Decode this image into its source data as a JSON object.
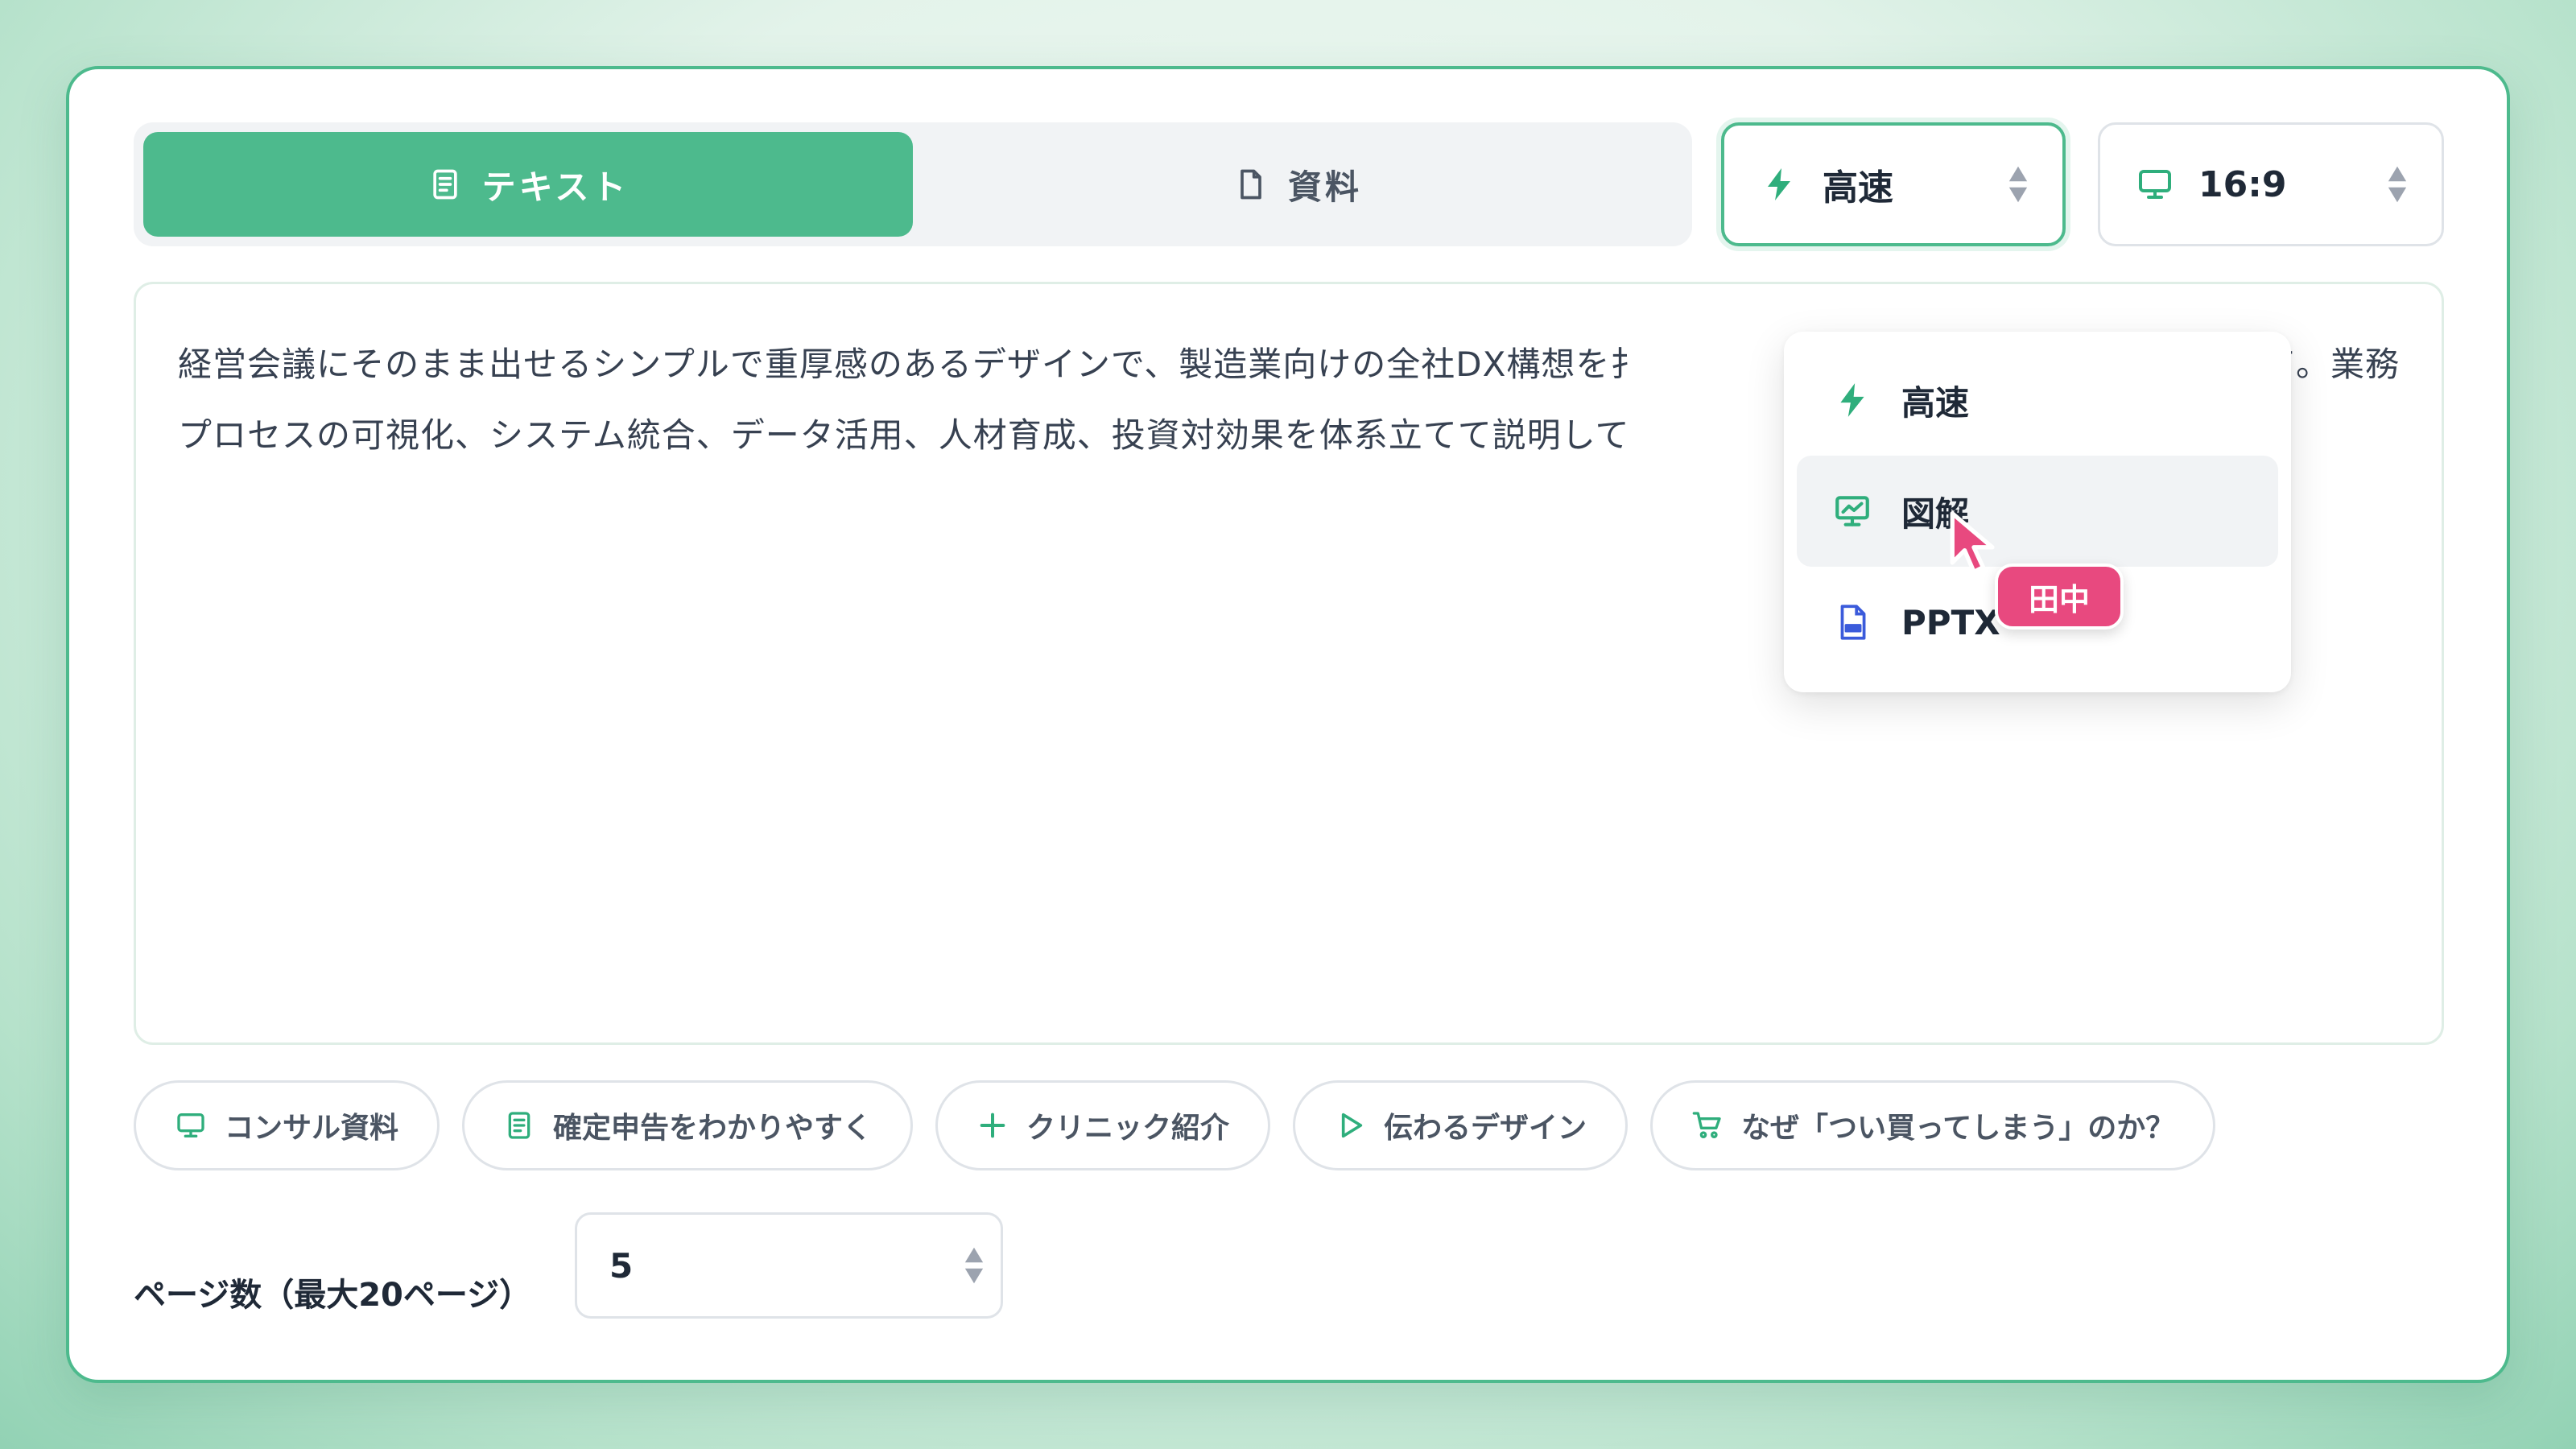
{
  "tabs": [
    {
      "label": "テキスト",
      "icon": "document-lines-icon",
      "active": true
    },
    {
      "label": "資料",
      "icon": "file-icon",
      "active": false
    }
  ],
  "mode_select": {
    "value": "高速",
    "icon": "lightning-icon"
  },
  "ratio_select": {
    "value": "16:9",
    "icon": "monitor-icon"
  },
  "prompt": {
    "line1": "経営会議にそのまま出せるシンプルで重厚感のあるデザインで、製造業向けの全社DX構想を扌",
    "line1_tail": "て。業務",
    "line2": "プロセスの可視化、システム統合、データ活用、人材育成、投資対効果を体系立てて説明して"
  },
  "suggestions": [
    {
      "label": "コンサル資料",
      "icon": "monitor-icon"
    },
    {
      "label": "確定申告をわかりやすく",
      "icon": "document-lines-icon"
    },
    {
      "label": "クリニック紹介",
      "icon": "plus-icon"
    },
    {
      "label": "伝わるデザイン",
      "icon": "play-icon"
    },
    {
      "label": "なぜ「つい買ってしまう」のか？",
      "icon": "cart-icon"
    }
  ],
  "page_count": {
    "label": "ページ数（最大20ページ）",
    "value": "5"
  },
  "mode_menu": {
    "items": [
      {
        "label": "高速",
        "icon": "lightning-icon"
      },
      {
        "label": "図解",
        "icon": "chart-presentation-icon",
        "hovered": true
      },
      {
        "label": "PPTX",
        "icon": "ppt-file-icon"
      }
    ]
  },
  "collaborator": {
    "name": "田中",
    "color": "#e8497f"
  },
  "colors": {
    "accent": "#4dba8d",
    "badge": "#e8497f"
  }
}
